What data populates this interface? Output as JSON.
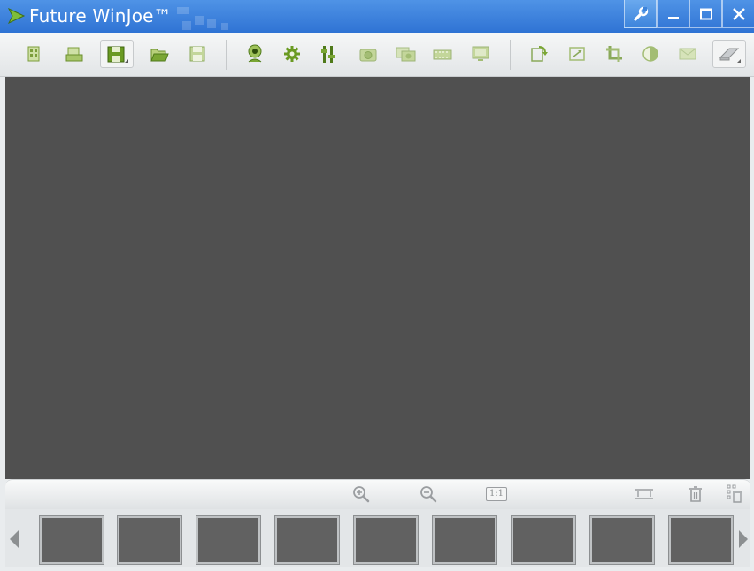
{
  "app": {
    "title": "Future WinJoe™",
    "title_color": "#ffffff",
    "titlebar_color": "#3a80dc",
    "logo_icon": "play-arrow-logo-icon"
  },
  "window_controls": [
    {
      "name": "settings-wrench",
      "icon": "wrench-icon"
    },
    {
      "name": "minimize",
      "icon": "minimize-icon"
    },
    {
      "name": "maximize",
      "icon": "maximize-icon"
    },
    {
      "name": "close",
      "icon": "close-icon"
    }
  ],
  "toolbar": {
    "groups": [
      [
        "document-icon",
        "import-icon",
        "save-as-icon",
        "open-folder-icon",
        "save-icon"
      ],
      [
        "webcam-icon",
        "settings-gear-icon",
        "adjust-sliders-icon",
        "camera-icon",
        "burst-capture-icon",
        "film-strip-icon",
        "monitor-icon"
      ],
      [
        "rotate-icon",
        "resize-icon",
        "crop-icon",
        "brightness-icon",
        "mail-icon",
        "eraser-icon"
      ]
    ],
    "accent_color": "#6f9a2c"
  },
  "viewer": {
    "background": "#505050"
  },
  "zoom_bar": {
    "one_to_one_label": "1:1",
    "controls": [
      "zoom-in-icon",
      "zoom-out-icon",
      "actual-size-button",
      "fit-width-icon",
      "trash-icon",
      "delete-all-icon"
    ]
  },
  "thumbnail_strip": {
    "thumbnail_count": 9,
    "thumbnail_color": "#616161",
    "left_arrow_icon": "scroll-left-icon",
    "right_arrow_icon": "scroll-right-icon"
  }
}
